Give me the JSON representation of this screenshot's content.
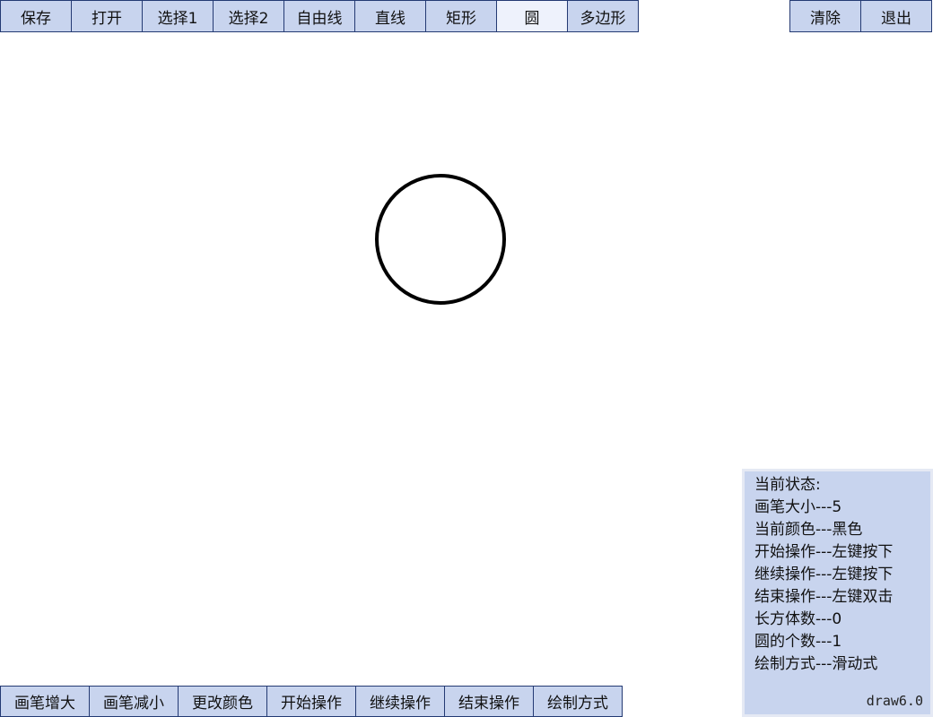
{
  "top_toolbar_left": [
    {
      "label": "保存",
      "name": "save-button",
      "active": false
    },
    {
      "label": "打开",
      "name": "open-button",
      "active": false
    },
    {
      "label": "选择1",
      "name": "select1-button",
      "active": false
    },
    {
      "label": "选择2",
      "name": "select2-button",
      "active": false
    },
    {
      "label": "自由线",
      "name": "freehand-button",
      "active": false
    },
    {
      "label": "直线",
      "name": "line-button",
      "active": false
    },
    {
      "label": "矩形",
      "name": "rectangle-button",
      "active": false
    },
    {
      "label": "圆",
      "name": "circle-button",
      "active": true
    },
    {
      "label": "多边形",
      "name": "polygon-button",
      "active": false
    }
  ],
  "top_toolbar_right": [
    {
      "label": "清除",
      "name": "clear-button"
    },
    {
      "label": "退出",
      "name": "exit-button"
    }
  ],
  "bottom_toolbar": [
    {
      "label": "画笔增大",
      "name": "pen-increase-button"
    },
    {
      "label": "画笔减小",
      "name": "pen-decrease-button"
    },
    {
      "label": "更改颜色",
      "name": "change-color-button"
    },
    {
      "label": "开始操作",
      "name": "start-operation-button"
    },
    {
      "label": "继续操作",
      "name": "continue-operation-button"
    },
    {
      "label": "结束操作",
      "name": "end-operation-button"
    },
    {
      "label": "绘制方式",
      "name": "draw-mode-button"
    }
  ],
  "status": {
    "title": "当前状态:",
    "lines": [
      "画笔大小---5",
      "当前颜色---黑色",
      "开始操作---左键按下",
      "继续操作---左键按下",
      "结束操作---左键双击",
      "长方体数---0",
      "圆的个数---1",
      "绘制方式---滑动式"
    ],
    "version": "draw6.0"
  },
  "colors": {
    "button_bg": "#c8d4ee",
    "button_active_bg": "#eef2fc",
    "button_border": "#243a73",
    "stroke": "#000000"
  }
}
